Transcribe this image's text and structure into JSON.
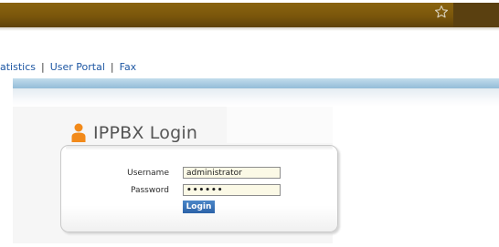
{
  "nav": {
    "items": [
      {
        "label": "atistics"
      },
      {
        "label": "User Portal"
      },
      {
        "label": "Fax"
      }
    ],
    "separator": "|"
  },
  "login": {
    "title": "IPPBX Login",
    "username_label": "Username",
    "username_value": "administrator",
    "password_label": "Password",
    "password_value": "••••••",
    "button_label": "Login"
  },
  "colors": {
    "topbar": "#7a560b",
    "nav_link": "#1e57a3",
    "blue_bar": "#a6c9e0",
    "button": "#2d63a8",
    "field_bg": "#fbf9e6",
    "user_icon": "#f28a1a"
  },
  "icons": {
    "topbar_right": "star-outline-icon",
    "title": "user-icon"
  }
}
